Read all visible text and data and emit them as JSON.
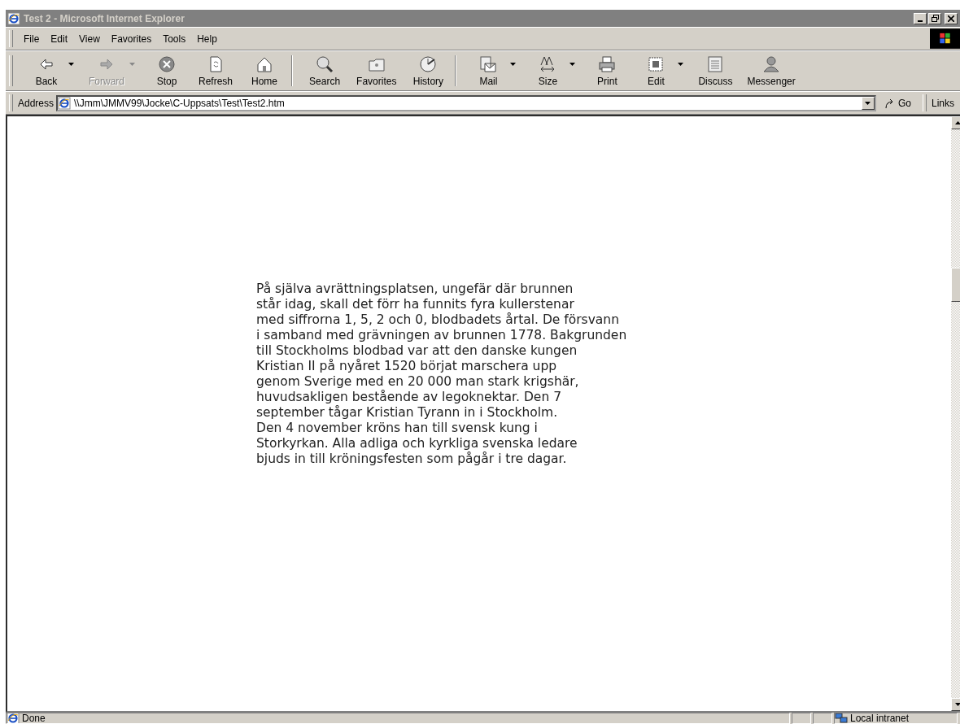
{
  "window": {
    "title": "Test 2 - Microsoft Internet Explorer"
  },
  "menu": [
    "File",
    "Edit",
    "View",
    "Favorites",
    "Tools",
    "Help"
  ],
  "toolbar": [
    {
      "kind": "back",
      "label": "Back",
      "disabled": false,
      "dropdown": true
    },
    {
      "kind": "forward",
      "label": "Forward",
      "disabled": true,
      "dropdown": true
    },
    {
      "kind": "stop",
      "label": "Stop",
      "disabled": false,
      "dropdown": false
    },
    {
      "kind": "refresh",
      "label": "Refresh",
      "disabled": false,
      "dropdown": false
    },
    {
      "kind": "home",
      "label": "Home",
      "disabled": false,
      "dropdown": false
    },
    {
      "kind": "separator"
    },
    {
      "kind": "search",
      "label": "Search",
      "disabled": false,
      "dropdown": false
    },
    {
      "kind": "favorites",
      "label": "Favorites",
      "disabled": false,
      "dropdown": false
    },
    {
      "kind": "history",
      "label": "History",
      "disabled": false,
      "dropdown": false
    },
    {
      "kind": "separator"
    },
    {
      "kind": "mail",
      "label": "Mail",
      "disabled": false,
      "dropdown": true
    },
    {
      "kind": "size",
      "label": "Size",
      "disabled": false,
      "dropdown": true
    },
    {
      "kind": "print",
      "label": "Print",
      "disabled": false,
      "dropdown": false
    },
    {
      "kind": "edit",
      "label": "Edit",
      "disabled": false,
      "dropdown": true
    },
    {
      "kind": "discuss",
      "label": "Discuss",
      "disabled": false,
      "dropdown": false
    },
    {
      "kind": "messenger",
      "label": "Messenger",
      "disabled": false,
      "dropdown": false
    }
  ],
  "address_bar": {
    "label": "Address",
    "value": "\\\\Jmm\\JMMV99\\Jocke\\C-Uppsats\\Test\\Test2.htm",
    "go": "Go",
    "links": "Links"
  },
  "page": {
    "lines": [
      "På själva avrättningsplatsen, ungefär där brunnen",
      "står idag, skall det förr ha funnits fyra kullerstenar",
      "med siffrorna 1, 5, 2 och 0, blodbadets årtal. De försvann",
      "i samband med grävningen av brunnen 1778. Bakgrunden",
      "till Stockholms blodbad var att den danske kungen",
      "Kristian II på nyåret 1520 börjat marschera upp",
      "genom Sverige med en 20 000 man stark krigshär,",
      "huvudsakligen bestående av legoknektar. Den 7",
      "september tågar Kristian Tyrann in i Stockholm.",
      "Den 4 november kröns han till svensk kung i",
      "Storkyrkan. Alla adliga och kyrkliga svenska ledare",
      "bjuds in till kröningsfesten som pågår i tre dagar."
    ]
  },
  "status_bar": {
    "text": "Done",
    "zone": "Local intranet"
  }
}
